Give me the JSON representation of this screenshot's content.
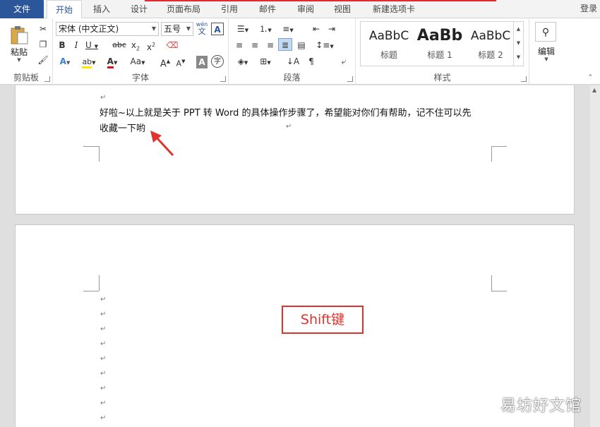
{
  "tabs": {
    "file": "文件",
    "items": [
      "开始",
      "插入",
      "设计",
      "页面布局",
      "引用",
      "邮件",
      "审阅",
      "视图",
      "新建选项卡"
    ],
    "login": "登录"
  },
  "clipboard": {
    "paste": "粘贴",
    "label": "剪贴板"
  },
  "font": {
    "name": "宋体 (中文正文)",
    "size": "五号",
    "wen": "wén",
    "wen_char": "文",
    "label": "字体"
  },
  "paragraph": {
    "label": "段落"
  },
  "styles": {
    "items": [
      {
        "preview": "AaBbC",
        "name": "标题"
      },
      {
        "preview": "AaBb",
        "name": "标题 1"
      },
      {
        "preview": "AaBbC",
        "name": "标题 2"
      }
    ],
    "label": "样式"
  },
  "editing": {
    "label": "编辑"
  },
  "document": {
    "para1_line1": "好啦~以上就是关于 PPT 转 Word 的具体操作步骤了，希望能对你们有帮助，记不住可以先",
    "para1_line2": "收藏一下哟",
    "return_mark": "↵"
  },
  "annotation": {
    "shift_label": "Shift键"
  },
  "watermark": "易坊好文馆",
  "colors": {
    "accent": "#2b579a",
    "annotation": "#e0332d"
  }
}
